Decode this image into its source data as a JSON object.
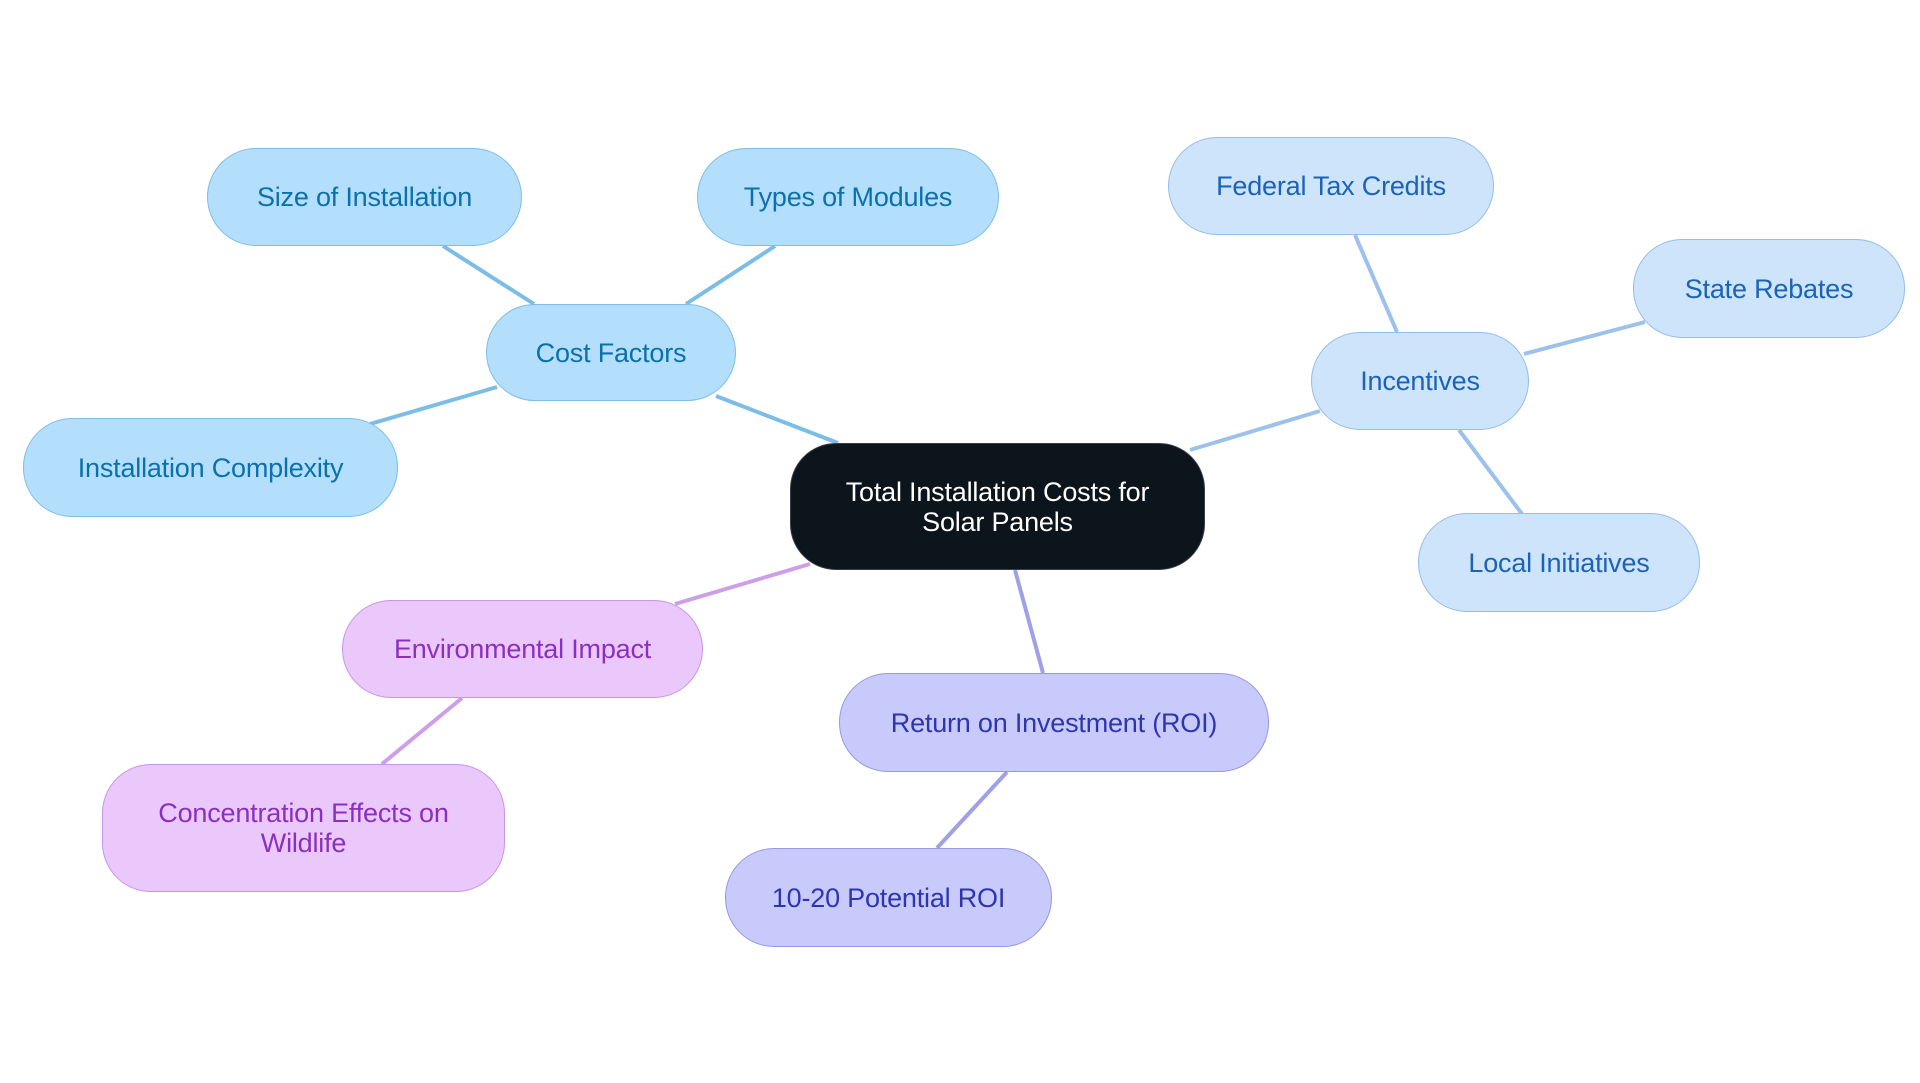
{
  "diagram": {
    "type": "mind-map",
    "root": {
      "id": "root",
      "label": "Total Installation Costs for Solar Panels",
      "lines": [
        "Total Installation Costs for",
        "Solar Panels"
      ]
    },
    "branches": [
      {
        "id": "cost-factors",
        "label": "Cost Factors",
        "color": "#7cbde8",
        "children": [
          {
            "id": "size-of-installation",
            "label": "Size of Installation"
          },
          {
            "id": "types-of-modules",
            "label": "Types of Modules"
          },
          {
            "id": "installation-complexity",
            "label": "Installation Complexity"
          }
        ]
      },
      {
        "id": "incentives",
        "label": "Incentives",
        "color": "#9cc2ec",
        "children": [
          {
            "id": "federal-tax-credits",
            "label": "Federal Tax Credits"
          },
          {
            "id": "state-rebates",
            "label": "State Rebates"
          },
          {
            "id": "local-initiatives",
            "label": "Local Initiatives"
          }
        ]
      },
      {
        "id": "environmental-impact",
        "label": "Environmental Impact",
        "color": "#cc9fe8",
        "children": [
          {
            "id": "concentration-effects",
            "label": "Concentration Effects on Wildlife",
            "lines": [
              "Concentration Effects on",
              "Wildlife"
            ]
          }
        ]
      },
      {
        "id": "roi",
        "label": "Return on Investment (ROI)",
        "color": "#9ea0e8",
        "children": [
          {
            "id": "potential-roi",
            "label": "10-20 Potential ROI"
          }
        ]
      }
    ]
  },
  "colors": {
    "root_fill": "#0c141c",
    "cost_fill": "#b3dffc",
    "cost_text": "#0b70ad",
    "incentives_fill": "#cde4fb",
    "incentives_text": "#1b63b8",
    "environment_fill": "#eac8fb",
    "environment_text": "#8b2fc0",
    "roi_fill": "#c8cafc",
    "roi_text": "#2e35b0"
  }
}
